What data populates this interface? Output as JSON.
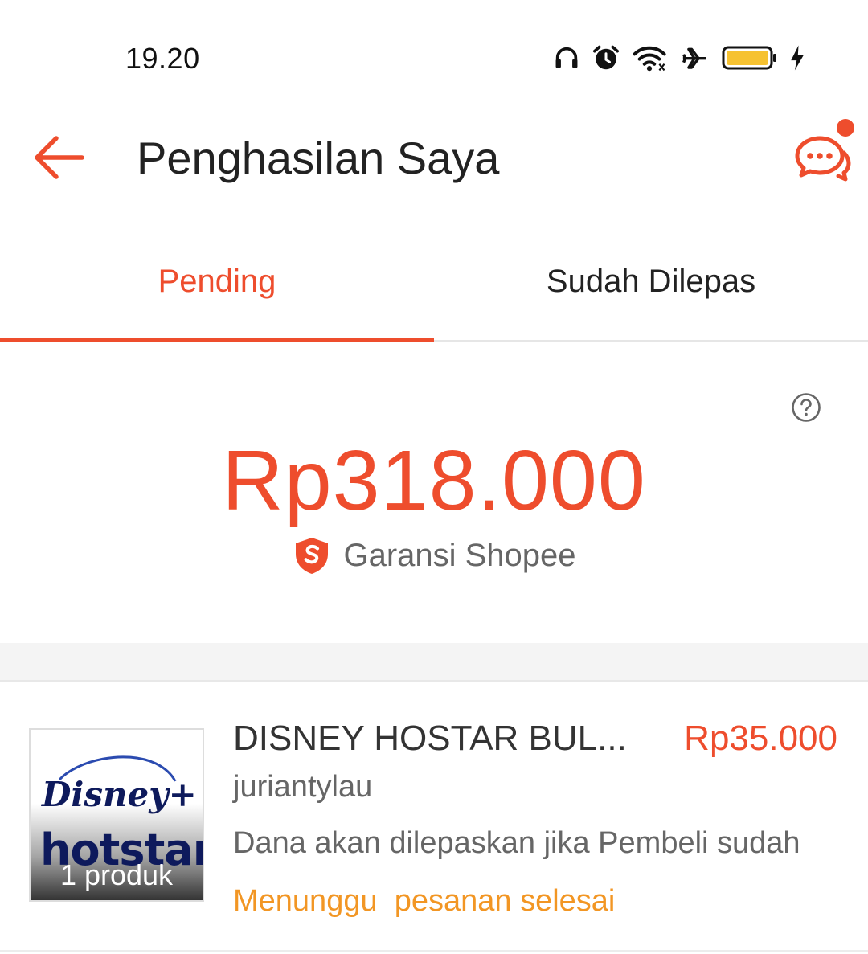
{
  "status_bar": {
    "time": "19.20",
    "icons": [
      "headphones-icon",
      "alarm-icon",
      "wifi-icon",
      "airplane-icon",
      "battery-icon",
      "charging-icon"
    ],
    "battery_color": "#f6c231"
  },
  "header": {
    "title": "Penghasilan Saya",
    "back_icon": "arrow-left-icon",
    "chat_icon": "chat-bubbles-icon",
    "has_notification": true
  },
  "tabs": [
    {
      "label": "Pending",
      "active": true
    },
    {
      "label": "Sudah Dilepas",
      "active": false
    }
  ],
  "summary": {
    "total": "Rp318.000",
    "guarantee_label": "Garansi Shopee",
    "help_icon": "question-circle-icon"
  },
  "orders": [
    {
      "name": "DISNEY HOSTAR BUL...",
      "price": "Rp35.000",
      "buyer": "juriantylau",
      "note": "Dana akan dilepaskan jika Pembeli sudah",
      "status": "Menunggu  pesanan selesai",
      "product_count": "1 produk",
      "thumbnail_logo": {
        "line1": "Disney+",
        "line2": "hotstar"
      }
    }
  ],
  "colors": {
    "accent": "#ee4d2d",
    "status_pending": "#f29624",
    "muted_text": "#666666"
  }
}
